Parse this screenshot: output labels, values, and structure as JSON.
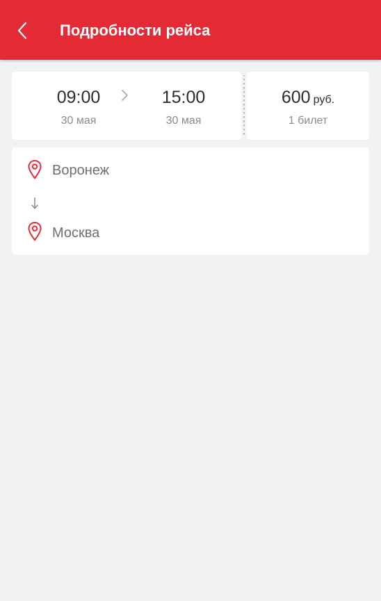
{
  "header": {
    "title": "Подробности рейса"
  },
  "trip": {
    "departure_time": "09:00",
    "departure_date": "30 мая",
    "arrival_time": "15:00",
    "arrival_date": "30 мая",
    "price_value": "600",
    "price_currency": "руб.",
    "tickets_label": "1 билет"
  },
  "route": {
    "from_city": "Воронеж",
    "to_city": "Москва"
  },
  "icons": {
    "back": "chevron-left-icon",
    "direction": "chevron-right-icon",
    "location": "map-pin-icon",
    "arrow": "arrow-down-icon"
  },
  "colors": {
    "accent": "#e42a35",
    "background": "#f2f1f4",
    "card": "#ffffff",
    "primary_text": "#2c2c2c",
    "secondary_text": "#8a8a8a"
  }
}
